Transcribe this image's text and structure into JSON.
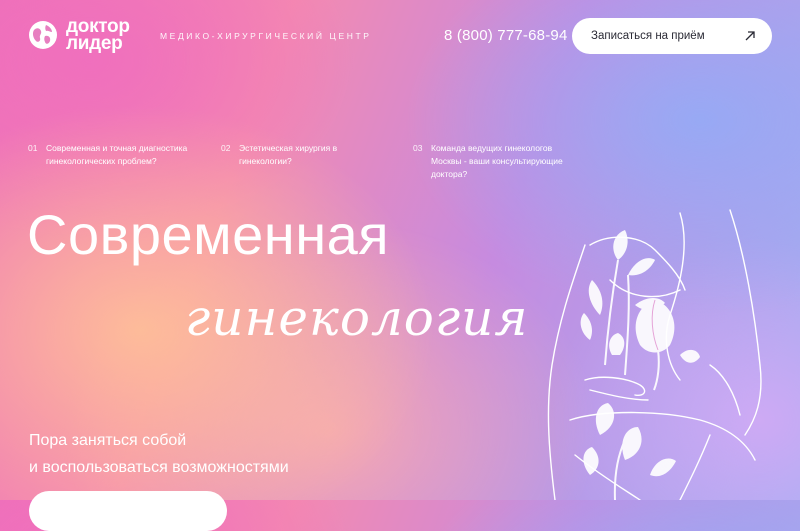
{
  "brand": {
    "line1": "доктор",
    "line2": "лидер"
  },
  "header": {
    "tagline": "Медико-хирургический центр",
    "phone": "8 (800) 777-68-94",
    "cta_label": "Записаться на приём"
  },
  "links": [
    {
      "num": "01",
      "text": "Современная и точная диагностика\nгинекологических проблем?"
    },
    {
      "num": "02",
      "text": "Эстетическая хирургия в\nгинекологии?"
    },
    {
      "num": "03",
      "text": "Команда ведущих гинекологов\nМосквы - ваши консультирующие\nдоктора?"
    }
  ],
  "hero": {
    "title_line1": "Современная",
    "title_line2": "гинекология",
    "subtitle_line1": "Пора заняться собой",
    "subtitle_line2": "и воспользоваться возможностями"
  },
  "colors": {
    "text": "#ffffff",
    "button_bg": "#ffffff",
    "button_text": "#2a2a35"
  },
  "icons": {
    "logo": "globe-logo-icon",
    "cta": "arrow-up-right-icon",
    "illustration": "woman-flowers-illustration"
  }
}
